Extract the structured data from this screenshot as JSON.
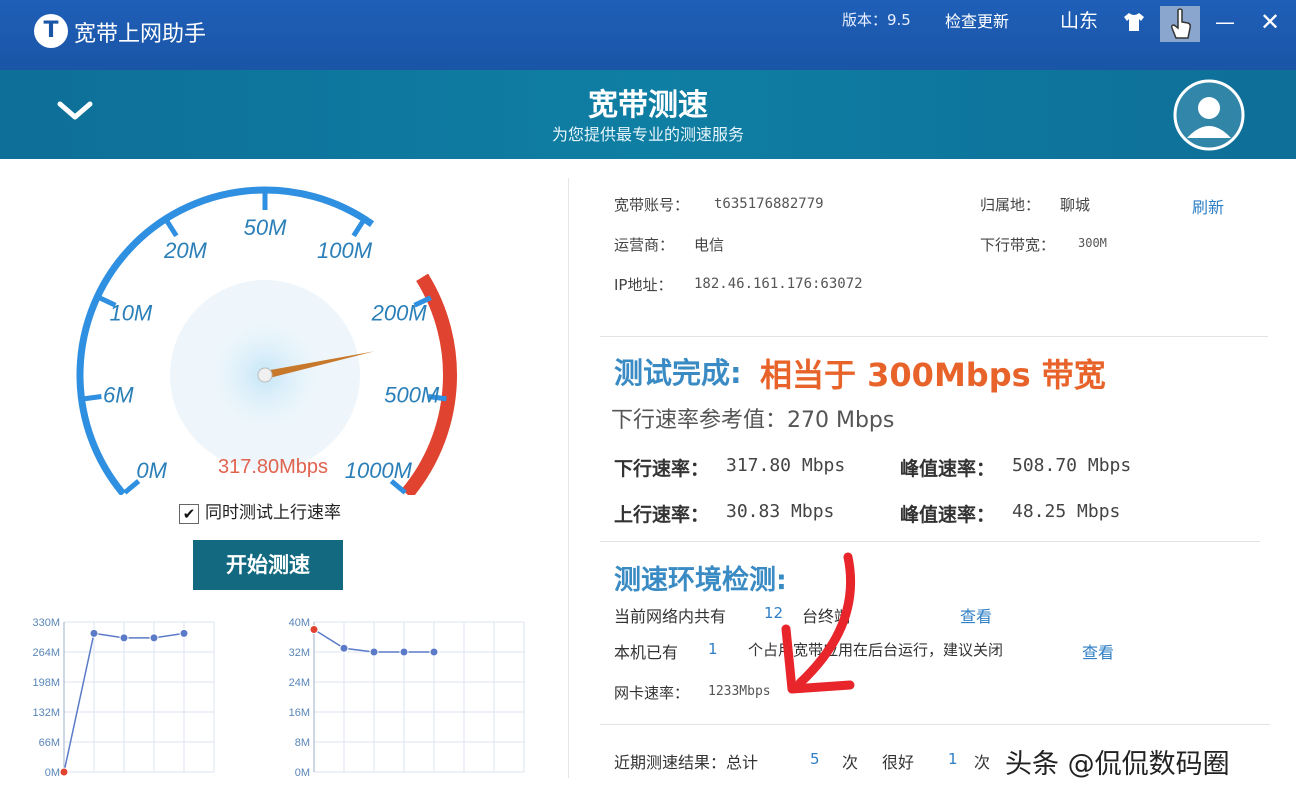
{
  "titlebar": {
    "app_name": "宽带上网助手",
    "version": "版本：9.5",
    "check_update": "检查更新",
    "region": "山东"
  },
  "header": {
    "title": "宽带测速",
    "subtitle": "为您提供最专业的测速服务"
  },
  "gauge": {
    "labels": [
      "0M",
      "6M",
      "10M",
      "20M",
      "50M",
      "100M",
      "200M",
      "500M",
      "1000M"
    ],
    "reading": "317.80Mbps",
    "needle_value_mbps": 317.8,
    "colors": {
      "blue": "#2f8fe0",
      "red": "#e0432f",
      "needle": "#c8782a"
    }
  },
  "controls": {
    "upload_checkbox_label": "同时测试上行速率",
    "upload_checked": true,
    "check_mark": "✔",
    "start_button": "开始测速"
  },
  "chart_data": [
    {
      "type": "line",
      "title": "",
      "y_ticks": [
        "330M",
        "264M",
        "198M",
        "132M",
        "66M",
        "0M"
      ],
      "ylim": [
        0,
        330
      ],
      "x": [
        1,
        2,
        3,
        4,
        5
      ],
      "values": [
        0,
        305,
        295,
        295,
        305
      ],
      "series_color": "#5b7bc8",
      "start_point_color": "#e0432f",
      "grid": true
    },
    {
      "type": "line",
      "title": "",
      "y_ticks": [
        "40M",
        "32M",
        "24M",
        "16M",
        "8M",
        "0M"
      ],
      "ylim": [
        0,
        40
      ],
      "x": [
        1,
        2,
        3,
        4,
        5
      ],
      "values": [
        38,
        33,
        32,
        32,
        32
      ],
      "series_color": "#5b7bc8",
      "start_point_color": "#e0432f",
      "grid": true
    }
  ],
  "account": {
    "account_label": "宽带账号：",
    "account_value": "t635176882779",
    "location_label": "归属地：",
    "location_value": "聊城",
    "refresh": "刷新",
    "isp_label": "运营商：",
    "isp_value": "电信",
    "bandwidth_label": "下行带宽：",
    "bandwidth_value": "300M",
    "ip_label": "IP地址：",
    "ip_value": "182.46.161.176:63072"
  },
  "result": {
    "label": "测试完成:",
    "value": "相当于 300Mbps 带宽",
    "reference": "下行速率参考值：270 Mbps",
    "down_label": "下行速率：",
    "down_value": "317.80 Mbps",
    "down_peak_label": "峰值速率：",
    "down_peak_value": "508.70 Mbps",
    "up_label": "上行速率：",
    "up_value": "30.83 Mbps",
    "up_peak_label": "峰值速率：",
    "up_peak_value": "48.25 Mbps"
  },
  "environment": {
    "title": "测速环境检测:",
    "devices_prefix": "当前网络内共有",
    "devices_count": "12",
    "devices_suffix": "台终端",
    "view1": "查看",
    "apps_prefix": "本机已有",
    "apps_count": "1",
    "apps_suffix": "个占用宽带应用在后台运行，建议关闭",
    "view2": "查看",
    "nic_label": "网卡速率：",
    "nic_value": "1233Mbps"
  },
  "recent": {
    "label": "近期测速结果：总计",
    "total": "5",
    "unit1": "次",
    "good_label": "很好",
    "good": "1",
    "unit2": "次"
  },
  "watermark": "头条 @侃侃数码圈"
}
